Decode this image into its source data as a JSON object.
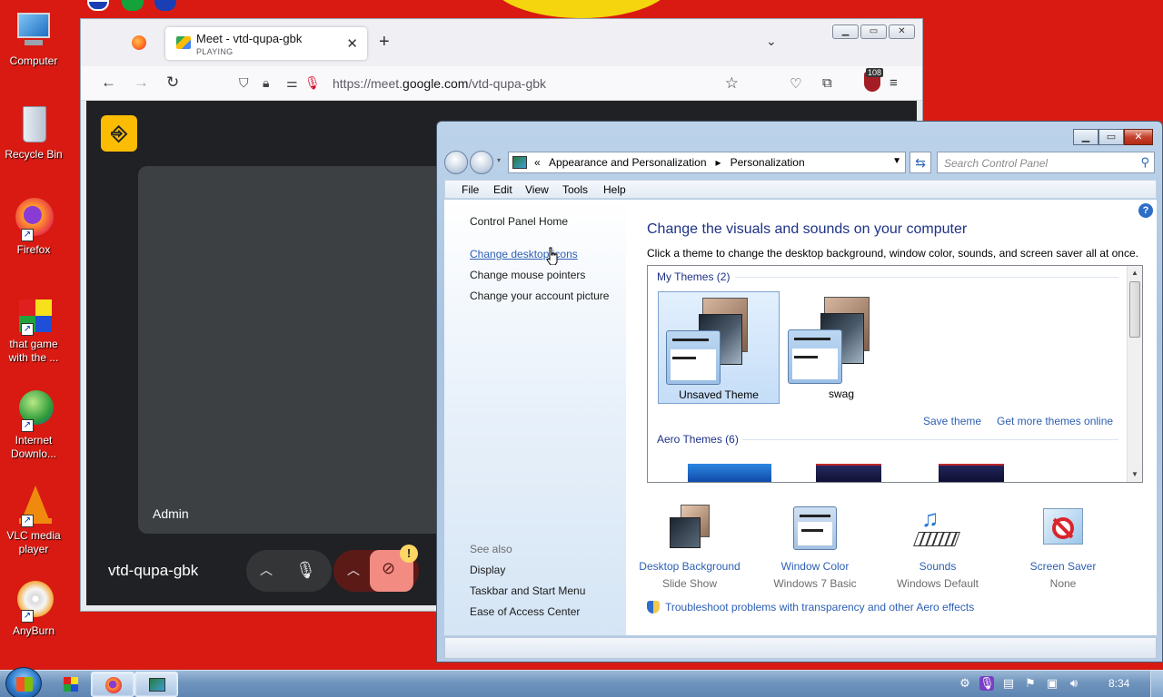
{
  "desktop": {
    "icons": [
      {
        "label_line1": "Computer",
        "label_line2": "",
        "icon": "computer-icon"
      },
      {
        "label_line1": "Recycle Bin",
        "label_line2": "",
        "icon": "recycle-bin-icon"
      },
      {
        "label_line1": "Firefox",
        "label_line2": "",
        "icon": "firefox-icon"
      },
      {
        "label_line1": "that game",
        "label_line2": "with the ...",
        "icon": "game-icon"
      },
      {
        "label_line1": "Internet",
        "label_line2": "Downlo...",
        "icon": "internet-download-manager-icon"
      },
      {
        "label_line1": "VLC media",
        "label_line2": "player",
        "icon": "vlc-icon"
      },
      {
        "label_line1": "AnyBurn",
        "label_line2": "",
        "icon": "anyburn-icon"
      }
    ]
  },
  "firefox": {
    "tab_title": "Meet - vtd-qupa-gbk",
    "tab_status": "PLAYING",
    "tab_close": "✕",
    "new_tab": "+",
    "url_base": "https://meet.",
    "url_domain": "google.com",
    "url_path": "/vtd-qupa-gbk",
    "extension_badge": "108",
    "colors": {
      "tab_bar": "#f0f0f4",
      "accent": "#15141a"
    }
  },
  "meet": {
    "participant_name": "Admin",
    "meeting_code": "vtd-qupa-gbk",
    "warning_badge": "!",
    "colors": {
      "background": "#202124",
      "tile": "#3c4043",
      "camera_off": "#f28b82"
    }
  },
  "control_panel": {
    "breadcrumb": {
      "prefix": "«",
      "item1": "Appearance and Personalization",
      "sep": "▸",
      "item2": "Personalization"
    },
    "search_placeholder": "Search Control Panel",
    "menu": [
      "File",
      "Edit",
      "View",
      "Tools",
      "Help"
    ],
    "sidebar": {
      "home": "Control Panel Home",
      "links": [
        "Change desktop icons",
        "Change mouse pointers",
        "Change your account picture"
      ],
      "see_also_title": "See also",
      "see_also": [
        "Display",
        "Taskbar and Start Menu",
        "Ease of Access Center"
      ]
    },
    "heading": "Change the visuals and sounds on your computer",
    "subheading": "Click a theme to change the desktop background, window color, sounds, and screen saver all at once.",
    "my_themes_header": "My Themes (2)",
    "themes": [
      {
        "name": "Unsaved Theme",
        "selected": true
      },
      {
        "name": "swag",
        "selected": false
      }
    ],
    "save_theme": "Save theme",
    "more_themes": "Get more themes online",
    "aero_header": "Aero Themes (6)",
    "options": [
      {
        "title": "Desktop Background",
        "value": "Slide Show",
        "icon": "desktop-background-icon"
      },
      {
        "title": "Window Color",
        "value": "Windows 7 Basic",
        "icon": "window-color-icon"
      },
      {
        "title": "Sounds",
        "value": "Windows Default",
        "icon": "sounds-icon"
      },
      {
        "title": "Screen Saver",
        "value": "None",
        "icon": "screen-saver-icon"
      }
    ],
    "troubleshoot": "Troubleshoot problems with transparency and other Aero effects",
    "help_glyph": "?"
  },
  "taskbar": {
    "clock": "8:34"
  }
}
